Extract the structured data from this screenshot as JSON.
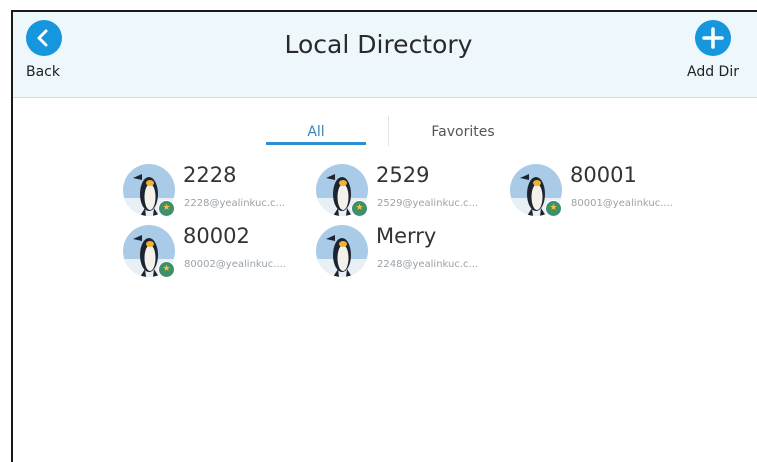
{
  "header": {
    "title": "Local Directory",
    "back_label": "Back",
    "add_label": "Add Dir"
  },
  "tabs": [
    {
      "label": "All",
      "active": true
    },
    {
      "label": "Favorites",
      "active": false
    }
  ],
  "contacts": [
    {
      "name": "2228",
      "email": "2228@yealinkuc.c...",
      "favorite": true
    },
    {
      "name": "2529",
      "email": "2529@yealinkuc.c...",
      "favorite": true
    },
    {
      "name": "80001",
      "email": "80001@yealinkuc....",
      "favorite": true
    },
    {
      "name": "80002",
      "email": "80002@yealinkuc....",
      "favorite": true
    },
    {
      "name": "Merry",
      "email": "2248@yealinkuc.c...",
      "favorite": false
    }
  ],
  "colors": {
    "accent": "#1596dd",
    "header_bg": "#edf7fc",
    "tab_active": "#2c8fcf",
    "badge": "#3f8f6b"
  },
  "icons": {
    "back": "chevron-left-icon",
    "add": "plus-icon",
    "favorite_badge": "star-icon"
  }
}
